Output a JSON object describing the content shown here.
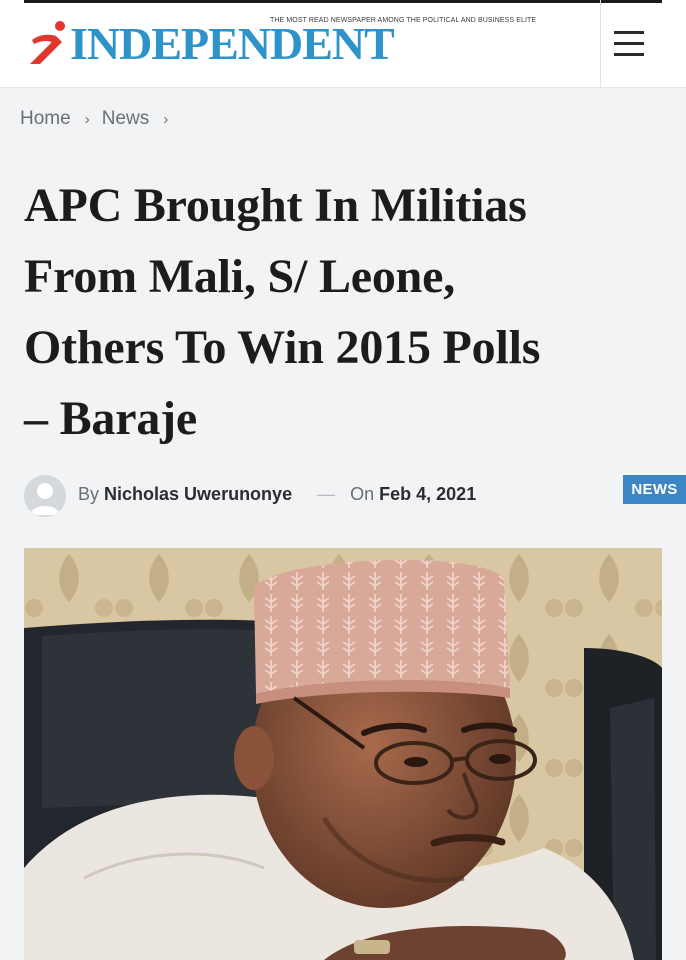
{
  "header": {
    "tagline": "THE MOST READ NEWSPAPER AMONG THE POLITICAL AND BUSINESS ELITE",
    "logo_text": "INDEPENDENT",
    "brand_color": "#2e93c9",
    "accent_color": "#e0362c",
    "menu_icon": "hamburger-icon"
  },
  "breadcrumb": {
    "items": [
      "Home",
      "News"
    ],
    "separator": "›"
  },
  "article": {
    "title_lines": [
      "APC Brought In Militias",
      "From Mali, S/ Leone,",
      "Others To Win 2015 Polls",
      "– Baraje"
    ],
    "by_label": "By",
    "author": "Nicholas Uwerunonye",
    "separator": "—",
    "on_label": "On",
    "date": "Feb 4, 2021",
    "category": "NEWS",
    "category_color": "#3d86c6",
    "avatar_icon": "user-avatar-icon",
    "image_icon": "portrait-photo"
  }
}
